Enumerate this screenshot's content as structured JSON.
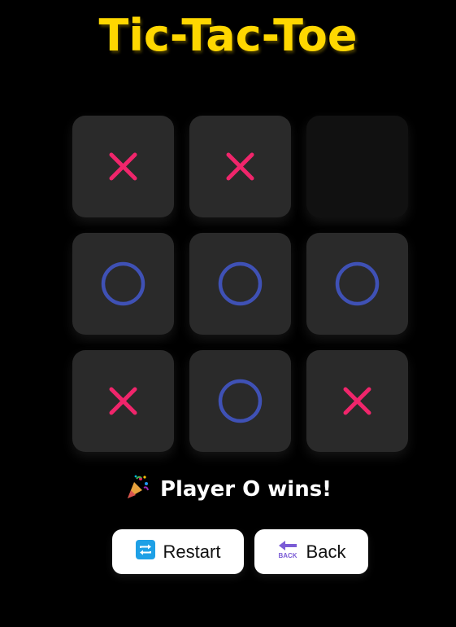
{
  "title": "Tic-Tac-Toe",
  "board": [
    [
      "X",
      "X",
      ""
    ],
    [
      "O",
      "O",
      "O"
    ],
    [
      "X",
      "O",
      "X"
    ]
  ],
  "colors": {
    "title": "#ffd700",
    "x_mark": "#f0256b",
    "o_mark": "#3f51b5",
    "cell": "#2a2a2a",
    "empty_cell": "#111111",
    "background": "#000000"
  },
  "status": {
    "emoji": "party-popper-icon",
    "text": "Player O wins!"
  },
  "buttons": {
    "restart": {
      "label": "Restart",
      "icon": "repeat-icon"
    },
    "back": {
      "label": "Back",
      "icon": "back-arrow-icon",
      "icon_text": "BACK"
    }
  }
}
